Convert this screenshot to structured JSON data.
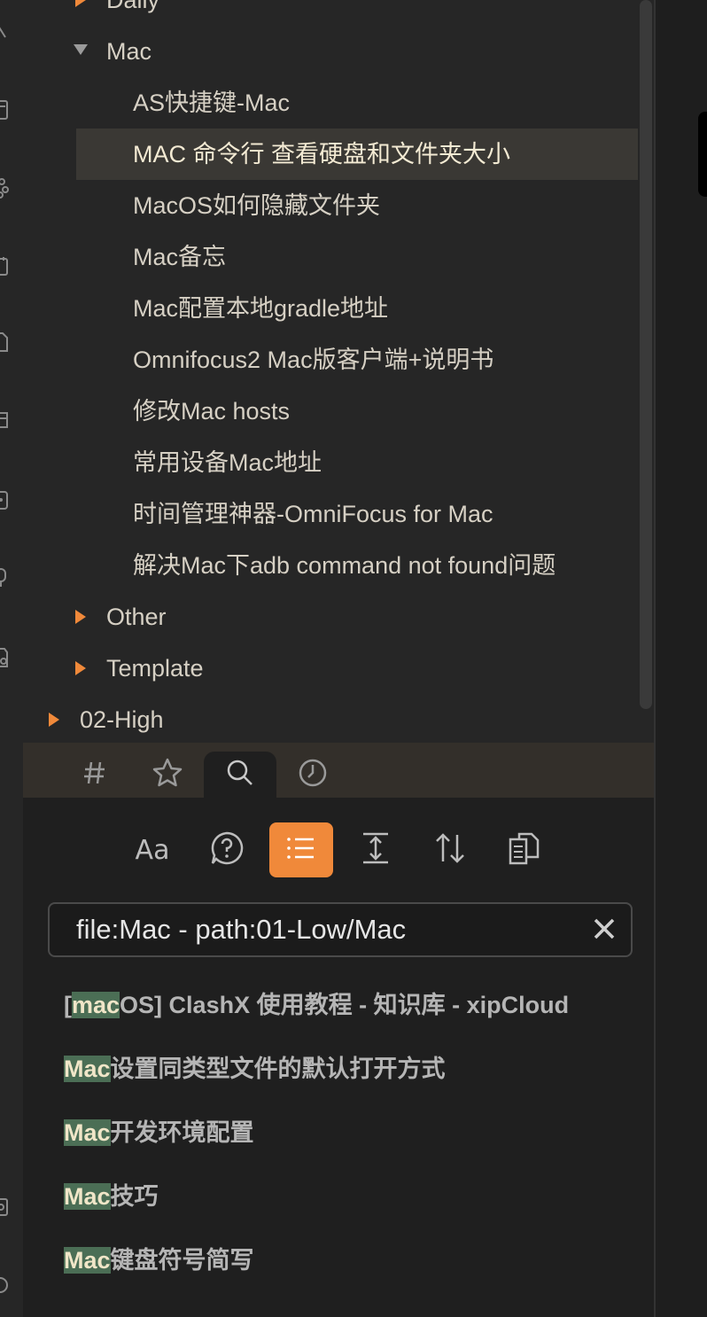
{
  "explorer": {
    "items": [
      {
        "label": "Daily",
        "expanded": false
      },
      {
        "label": "Mac",
        "expanded": true
      },
      {
        "label": "AS快捷键-Mac"
      },
      {
        "label": "MAC 命令行 查看硬盘和文件夹大小",
        "active": true
      },
      {
        "label": "MacOS如何隐藏文件夹"
      },
      {
        "label": "Mac备忘"
      },
      {
        "label": "Mac配置本地gradle地址"
      },
      {
        "label": "Omnifocus2 Mac版客户端+说明书"
      },
      {
        "label": "修改Mac hosts"
      },
      {
        "label": "常用设备Mac地址"
      },
      {
        "label": "时间管理神器-OmniFocus for Mac"
      },
      {
        "label": "解决Mac下adb command not found问题"
      },
      {
        "label": "Other",
        "expanded": false
      },
      {
        "label": "Template",
        "expanded": false
      },
      {
        "label": "02-High",
        "expanded": false
      }
    ]
  },
  "tabs": [
    {
      "icon": "hash-icon"
    },
    {
      "icon": "star-icon"
    },
    {
      "icon": "search-icon",
      "active": true
    },
    {
      "icon": "clock-icon"
    }
  ],
  "search": {
    "tools": [
      {
        "icon": "match-case-icon",
        "label": "Aa"
      },
      {
        "icon": "help-icon"
      },
      {
        "icon": "list-icon",
        "active": true
      },
      {
        "icon": "collapse-expand-icon"
      },
      {
        "icon": "sort-icon"
      },
      {
        "icon": "copy-icon"
      }
    ],
    "query": "file:Mac - path:01-Low/Mac",
    "results": [
      {
        "prefix": "[",
        "match": "mac",
        "suffix": "OS] ClashX 使用教程 - 知识库 - xipCloud"
      },
      {
        "prefix": "",
        "match": "Mac",
        "suffix": "设置同类型文件的默认打开方式"
      },
      {
        "prefix": "",
        "match": "Mac",
        "suffix": "开发环境配置"
      },
      {
        "prefix": "",
        "match": "Mac",
        "suffix": "技巧"
      },
      {
        "prefix": "",
        "match": "Mac",
        "suffix": "键盘符号简写"
      }
    ]
  },
  "colors": {
    "accent": "#f0893a",
    "highlight": "#4b6e55",
    "sidebar_bg": "#262626",
    "active_row_bg": "#3a3834"
  }
}
